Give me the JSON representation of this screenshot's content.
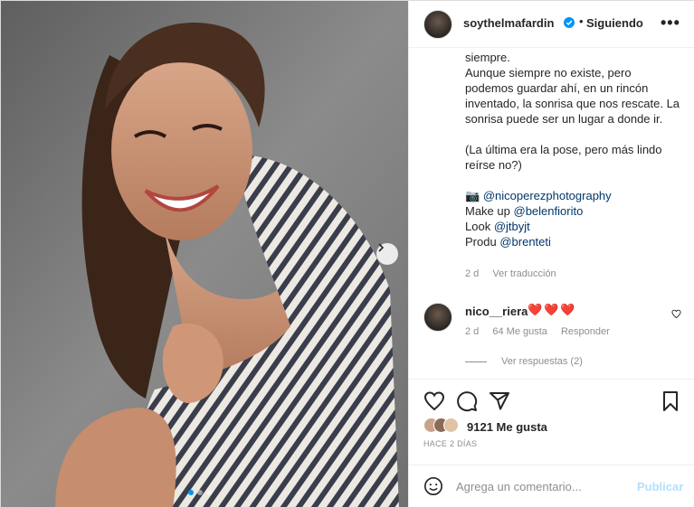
{
  "post": {
    "username": "soythelmafardin",
    "separator": "•",
    "follow_status": "Siguiendo",
    "more_label": "•••"
  },
  "caption": {
    "line_top": "siempre.",
    "paragraph1": "Aunque siempre no existe, pero podemos guardar ahí, en un rincón inventado, la sonrisa que nos rescate. La sonrisa puede ser un lugar a donde ir.",
    "paragraph2": "(La última era la pose, pero más lindo reírse no?)",
    "credit_photo_icon": "📷",
    "credit_photo": "@nicoperezphotography",
    "credit_makeup_label": "Make up",
    "credit_makeup": "@belenfiorito",
    "credit_look_label": "Look",
    "credit_look": "@jtbyjt",
    "credit_produ_label": "Produ",
    "credit_produ": "@brenteti",
    "time": "2 d",
    "translate": "Ver traducción"
  },
  "comment": {
    "user": "nico__riera",
    "text": "❤️❤️❤️",
    "time": "2 d",
    "likes": "64 Me gusta",
    "reply": "Responder",
    "view_replies": "Ver respuestas (2)"
  },
  "stats": {
    "likes": "9121 Me gusta",
    "time_ago": "HACE 2 DÍAS"
  },
  "add_comment": {
    "placeholder": "Agrega un comentario...",
    "publish": "Publicar"
  },
  "icons": {
    "like": "heart-icon",
    "comment": "comment-icon",
    "share": "paper-plane-icon",
    "save": "bookmark-icon",
    "emoji": "smiley-icon",
    "verified": "verified-badge-icon",
    "next": "chevron-right-icon"
  },
  "colors": {
    "mention": "#00376b",
    "verified": "#0095f6",
    "muted": "#8e8e8e",
    "publish_disabled": "#b2dffc",
    "hearts": "#e0245e"
  },
  "carousel": {
    "count": 3,
    "active_index": 0
  }
}
